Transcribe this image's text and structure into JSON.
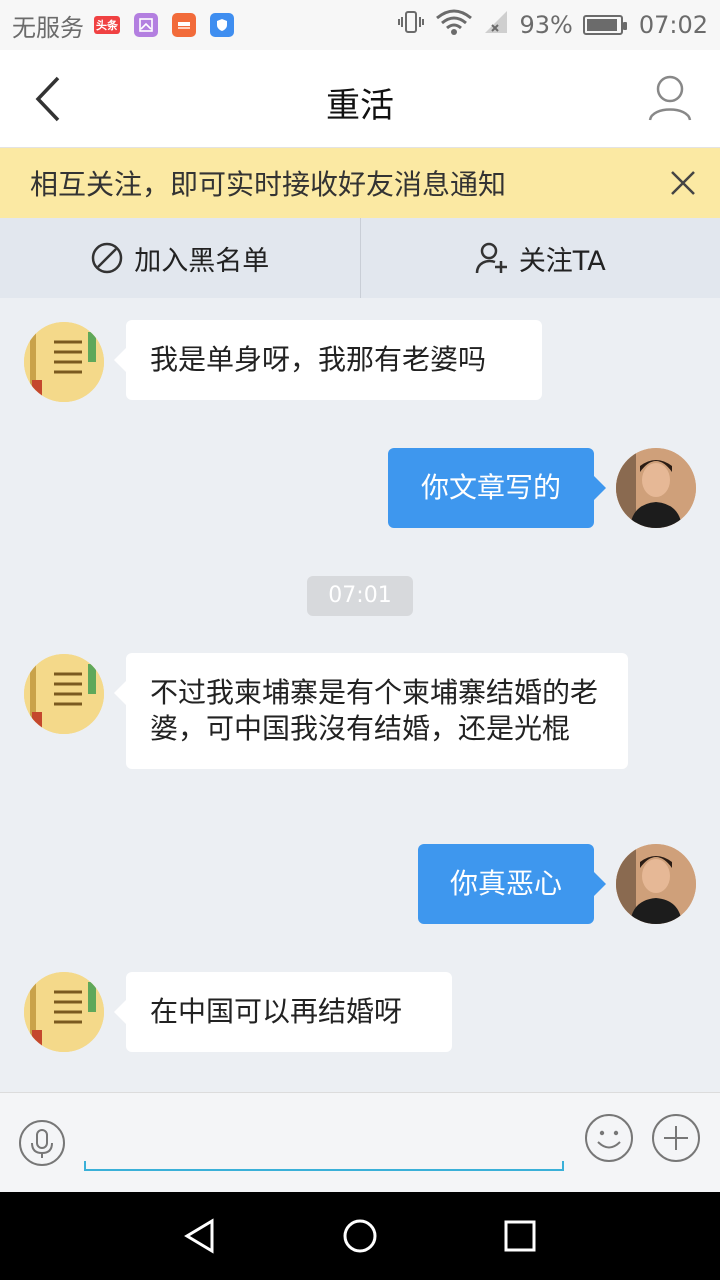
{
  "status_bar": {
    "carrier": "无服务",
    "apps": [
      {
        "name": "toutiao-app-icon",
        "label": "头条",
        "color": "#f04142"
      },
      {
        "name": "gallery-app-icon",
        "color": "#b37fe0"
      },
      {
        "name": "shopping-app-icon",
        "color": "#f26b3a"
      },
      {
        "name": "shield-app-icon",
        "color": "#3f8ef0"
      }
    ],
    "battery_percent": "93%",
    "battery_level": 0.93,
    "time": "07:02"
  },
  "header": {
    "title": "重活"
  },
  "notice": {
    "text": "相互关注，即可实时接收好友消息通知"
  },
  "actions": {
    "block_label": "加入黑名单",
    "follow_label": "关注TA"
  },
  "messages": [
    {
      "direction": "in",
      "text": "我是单身呀，我那有老婆吗"
    },
    {
      "direction": "out",
      "text": "你文章写的"
    },
    {
      "direction": "in",
      "text": "不过我柬埔寨是有个柬埔寨结婚的老婆，可中国我沒有结婚，还是光棍"
    },
    {
      "direction": "out",
      "text": "你真恶心"
    },
    {
      "direction": "in",
      "text": "在中国可以再结婚呀"
    }
  ],
  "timestamp": "07:01",
  "colors": {
    "accent": "#3e97ee",
    "notice_bg": "#fbe9a3",
    "chat_bg": "#eceff3",
    "input_underline": "#3ab0d8"
  }
}
